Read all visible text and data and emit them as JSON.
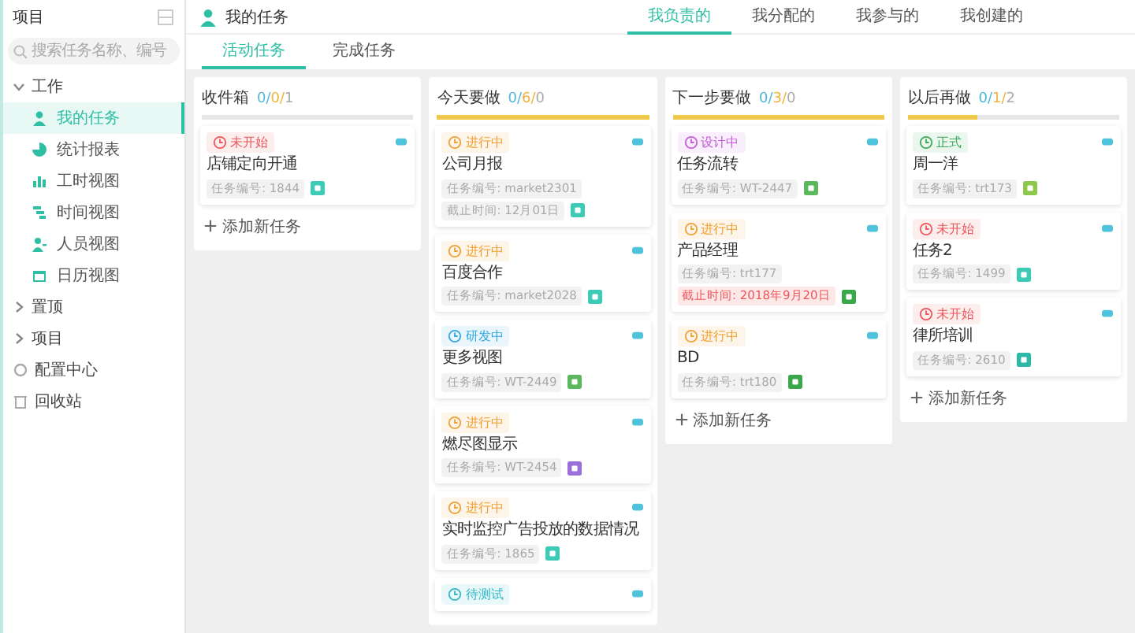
{
  "sidebar": {
    "title": "项目",
    "search": {
      "placeholder": "搜索任务名称、编号"
    },
    "tree": [
      {
        "label": "工作",
        "expanded": true,
        "children": [
          {
            "label": "我的任务",
            "selected": true
          },
          {
            "label": "统计报表",
            "selected": false
          },
          {
            "label": "工时视图",
            "selected": false
          },
          {
            "label": "时间视图",
            "selected": false
          },
          {
            "label": "人员视图",
            "selected": false
          },
          {
            "label": "日历视图",
            "selected": false
          }
        ]
      },
      {
        "label": "置顶",
        "expanded": false
      },
      {
        "label": "项目",
        "expanded": false
      }
    ],
    "links": [
      {
        "label": "配置中心"
      },
      {
        "label": "回收站"
      }
    ]
  },
  "header": {
    "title": "我的任务",
    "tabs": [
      {
        "label": "我负责的",
        "selected": true
      },
      {
        "label": "我分配的",
        "selected": false
      },
      {
        "label": "我参与的",
        "selected": false
      },
      {
        "label": "我创建的",
        "selected": false
      }
    ]
  },
  "subtabs": [
    {
      "label": "活动任务",
      "selected": true
    },
    {
      "label": "完成任务",
      "selected": false
    }
  ],
  "columns": [
    {
      "title": "收件箱",
      "counts": [
        {
          "text": "0/",
          "color": "#4cb8d6"
        },
        {
          "text": "0/",
          "color": "#f0b43c"
        },
        {
          "text": "1",
          "color": "#aaaaaa"
        }
      ],
      "level": 0,
      "add_label": "添加新任务",
      "cards": [
        {
          "status": {
            "label": "未开始",
            "color": "#f0555a"
          },
          "title": "店铺定向开通",
          "task_no": "任务编号: 1844",
          "type_icon": {
            "color": "#3ecbb5"
          }
        }
      ]
    },
    {
      "title": "今天要做",
      "counts": [
        {
          "text": "0/",
          "color": "#4cb8d6"
        },
        {
          "text": "6/",
          "color": "#f0b43c"
        },
        {
          "text": "0",
          "color": "#aaaaaa"
        }
      ],
      "level": 1,
      "cards": [
        {
          "status": {
            "label": "进行中",
            "color": "#f0a030"
          },
          "title": "公司月报",
          "task_no": "任务编号: market2301",
          "deadline": {
            "text": "截止时间: 12月01日",
            "overdue": false
          },
          "type_icon": {
            "color": "#3ecbb5"
          }
        },
        {
          "status": {
            "label": "进行中",
            "color": "#f0a030"
          },
          "title": "百度合作",
          "task_no": "任务编号: market2028",
          "type_icon": {
            "color": "#3ecbb5"
          }
        },
        {
          "status": {
            "label": "研发中",
            "color": "#2fa8e0"
          },
          "title": "更多视图",
          "task_no": "任务编号: WT-2449",
          "type_icon": {
            "color": "#5cb85c"
          }
        },
        {
          "status": {
            "label": "进行中",
            "color": "#f0a030"
          },
          "title": "燃尽图显示",
          "task_no": "任务编号: WT-2454",
          "type_icon": {
            "color": "#9b6fdb"
          }
        },
        {
          "status": {
            "label": "进行中",
            "color": "#f0a030"
          },
          "title": "实时监控广告投放的数据情况",
          "task_no": "任务编号: 1865",
          "type_icon": {
            "color": "#3ecbb5"
          }
        },
        {
          "status": {
            "label": "待测试",
            "color": "#2fb8c8"
          }
        }
      ]
    },
    {
      "title": "下一步要做",
      "counts": [
        {
          "text": "0/",
          "color": "#4cb8d6"
        },
        {
          "text": "3/",
          "color": "#f0b43c"
        },
        {
          "text": "0",
          "color": "#aaaaaa"
        }
      ],
      "level": 1,
      "add_label": "添加新任务",
      "cards": [
        {
          "status": {
            "label": "设计中",
            "color": "#c45ad8"
          },
          "title": "任务流转",
          "task_no": "任务编号: WT-2447",
          "type_icon": {
            "color": "#5cb85c"
          }
        },
        {
          "status": {
            "label": "进行中",
            "color": "#f0a030"
          },
          "title": "产品经理",
          "task_no": "任务编号: trt177",
          "deadline": {
            "text": "截止时间: 2018年9月20日",
            "overdue": true
          },
          "type_icon": {
            "color": "#3aa84a"
          }
        },
        {
          "status": {
            "label": "进行中",
            "color": "#f0a030"
          },
          "title": "BD",
          "task_no": "任务编号: trt180",
          "type_icon": {
            "color": "#3aa84a"
          }
        }
      ]
    },
    {
      "title": "以后再做",
      "counts": [
        {
          "text": "0/",
          "color": "#4cb8d6"
        },
        {
          "text": "1/",
          "color": "#f0b43c"
        },
        {
          "text": "2",
          "color": "#aaaaaa"
        }
      ],
      "level": 0.33,
      "add_label": "添加新任务",
      "cards": [
        {
          "status": {
            "label": "正式",
            "color": "#3aaa5a"
          },
          "title": "周一洋",
          "task_no": "任务编号: trt173",
          "type_icon": {
            "color": "#8cc84b"
          }
        },
        {
          "status": {
            "label": "未开始",
            "color": "#f0555a"
          },
          "title": "任务2",
          "task_no": "任务编号: 1499",
          "type_icon": {
            "color": "#3ecbb5"
          }
        },
        {
          "status": {
            "label": "未开始",
            "color": "#f0555a"
          },
          "title": "律所培训",
          "task_no": "任务编号: 2610",
          "type_icon": {
            "color": "#2fb8a8"
          }
        }
      ]
    }
  ]
}
